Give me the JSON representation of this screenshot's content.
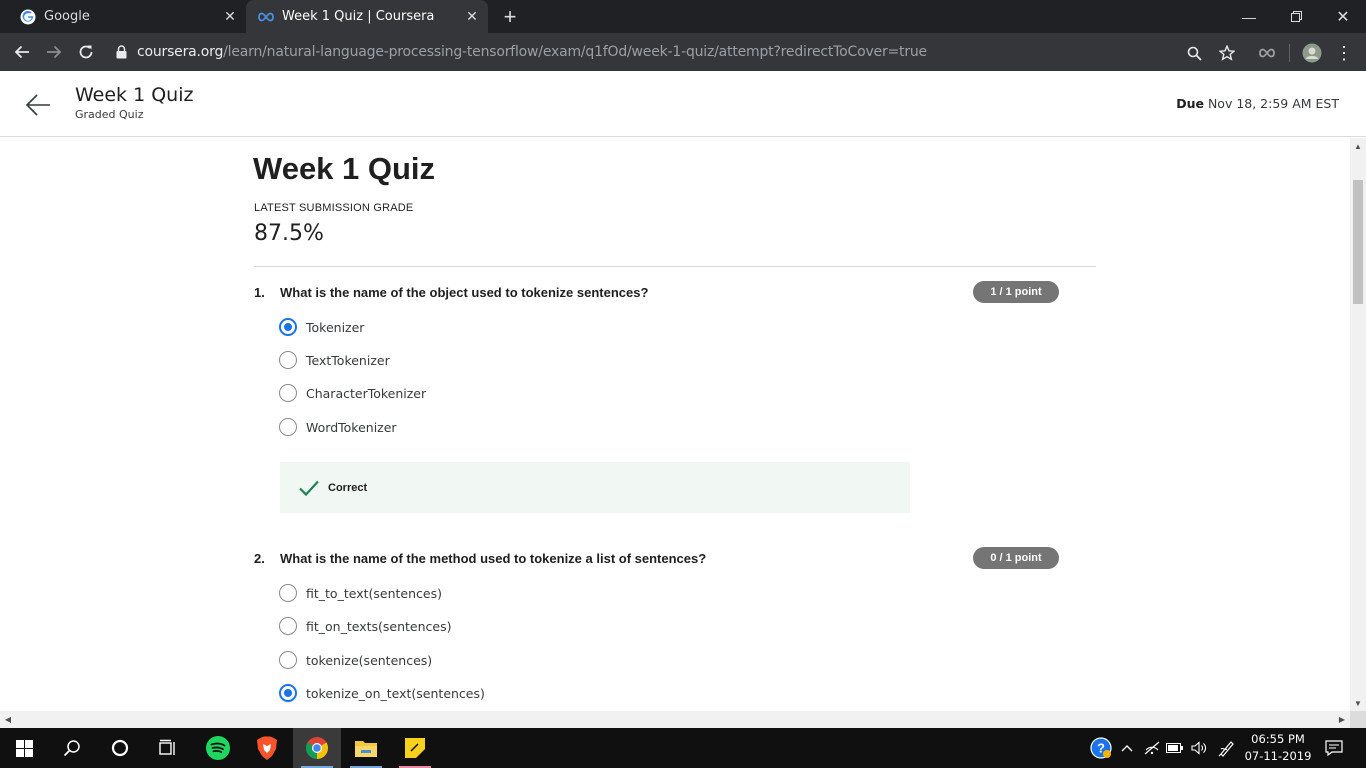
{
  "browser": {
    "tabs": [
      {
        "title": "Google",
        "icon": "google-g-icon"
      },
      {
        "title": "Week 1 Quiz | Coursera",
        "icon": "coursera-infinity-icon"
      }
    ],
    "url_host": "coursera.org",
    "url_path": "/learn/natural-language-processing-tensorflow/exam/q1fOd/week-1-quiz/attempt?redirectToCover=true"
  },
  "header": {
    "title": "Week 1 Quiz",
    "subtitle": "Graded Quiz",
    "due_label": "Due",
    "due_value": "Nov 18, 2:59 AM EST"
  },
  "quiz": {
    "title": "Week 1 Quiz",
    "grade_label": "LATEST SUBMISSION GRADE",
    "grade_value": "87.5%",
    "questions": [
      {
        "number": "1.",
        "text": "What is the name of the object used to tokenize sentences?",
        "points": "1 / 1 point",
        "options": [
          "Tokenizer",
          "TextTokenizer",
          "CharacterTokenizer",
          "WordTokenizer"
        ],
        "selected": 0,
        "feedback": "Correct"
      },
      {
        "number": "2.",
        "text": "What is the name of the method used to tokenize a list of sentences?",
        "points": "0 / 1 point",
        "options": [
          "fit_to_text(sentences)",
          "fit_on_texts(sentences)",
          "tokenize(sentences)",
          "tokenize_on_text(sentences)"
        ],
        "selected": 3
      }
    ]
  },
  "taskbar": {
    "time": "06:55 PM",
    "date": "07-11-2019"
  },
  "colors": {
    "accent": "#1a73e8",
    "correct": "#1f8354",
    "points_pill": "#757575"
  }
}
